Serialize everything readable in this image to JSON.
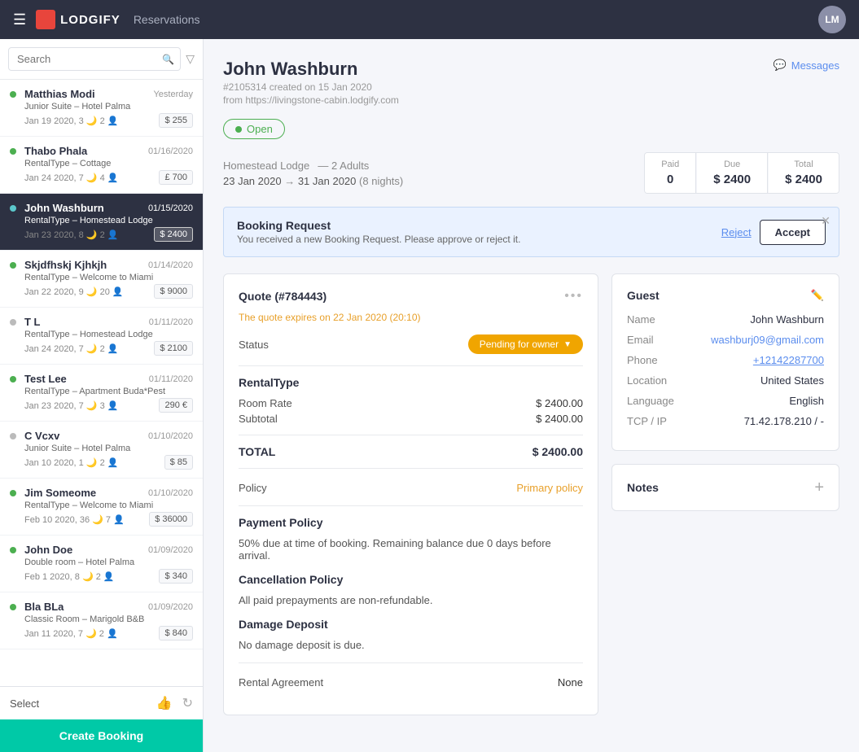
{
  "topnav": {
    "logo_text": "LODGIFY",
    "page_title": "Reservations",
    "avatar_initials": "LM"
  },
  "sidebar": {
    "search_placeholder": "Search",
    "select_label": "Select",
    "create_booking_label": "Create Booking",
    "items": [
      {
        "name": "Matthias Modi",
        "date": "Yesterday",
        "sub": "Junior Suite – Hotel Palma",
        "dates": "Jan 19 2020, 3",
        "adults": "2",
        "amount": "$ 255",
        "dot": "green",
        "active": false,
        "transfer": false
      },
      {
        "name": "Thabo Phala",
        "date": "01/16/2020",
        "sub": "RentalType – Cottage",
        "dates": "Jan 24 2020, 7",
        "adults": "4",
        "amount": "£ 700",
        "dot": "green",
        "active": false,
        "transfer": false
      },
      {
        "name": "John Washburn",
        "date": "01/15/2020",
        "sub": "RentalType – Homestead Lodge",
        "dates": "Jan 23 2020, 8",
        "adults": "2",
        "amount": "$ 2400",
        "dot": "green",
        "active": true,
        "transfer": true
      },
      {
        "name": "Skjdfhskj Kjhkjh",
        "date": "01/14/2020",
        "sub": "RentalType – Welcome to Miami",
        "dates": "Jan 22 2020, 9",
        "adults": "20",
        "amount": "$ 9000",
        "dot": "green",
        "active": false,
        "transfer": false
      },
      {
        "name": "T L",
        "date": "01/11/2020",
        "sub": "RentalType – Homestead Lodge",
        "dates": "Jan 24 2020, 7",
        "adults": "2",
        "amount": "$ 2100",
        "dot": "gray",
        "active": false,
        "transfer": true
      },
      {
        "name": "Test Lee",
        "date": "01/11/2020",
        "sub": "RentalType – Apartment Buda*Pest",
        "dates": "Jan 23 2020, 7",
        "adults": "3",
        "amount": "290 €",
        "dot": "green",
        "active": false,
        "transfer": false
      },
      {
        "name": "C Vcxv",
        "date": "01/10/2020",
        "sub": "Junior Suite – Hotel Palma",
        "dates": "Jan 10 2020, 1",
        "adults": "2",
        "amount": "$ 85",
        "dot": "gray",
        "active": false,
        "transfer": false
      },
      {
        "name": "Jim Someome",
        "date": "01/10/2020",
        "sub": "RentalType – Welcome to Miami",
        "dates": "Feb 10 2020, 36",
        "adults": "7",
        "amount": "$ 36000",
        "dot": "green",
        "active": false,
        "transfer": true
      },
      {
        "name": "John Doe",
        "date": "01/09/2020",
        "sub": "Double room – Hotel Palma",
        "dates": "Feb 1 2020, 8",
        "adults": "2",
        "amount": "$ 340",
        "dot": "green",
        "active": false,
        "transfer": false
      },
      {
        "name": "Bla BLa",
        "date": "01/09/2020",
        "sub": "Classic Room – Marigold B&B",
        "dates": "Jan 11 2020, 7",
        "adults": "2",
        "amount": "$ 840",
        "dot": "green",
        "active": false,
        "transfer": false
      }
    ]
  },
  "detail": {
    "guest_name": "John Washburn",
    "booking_id": "#2105314",
    "created": "created on 15 Jan 2020",
    "from_url": "from https://livingstone-cabin.lodgify.com",
    "status": "Open",
    "messages_label": "Messages",
    "property": "Homestead Lodge",
    "adults": "2 Adults",
    "check_in": "23 Jan 2020",
    "check_out": "31 Jan 2020",
    "nights": "8 nights",
    "paid_label": "Paid",
    "due_label": "Due",
    "total_label": "Total",
    "paid_value": "0",
    "due_value": "$ 2400",
    "total_value": "$ 2400",
    "alert": {
      "title": "Booking Request",
      "description": "You received a new Booking Request. Please approve or reject it.",
      "reject_label": "Reject",
      "accept_label": "Accept"
    },
    "quote": {
      "title": "Quote (#784443)",
      "expires": "The quote expires on 22 Jan 2020 (20:10)",
      "status_label": "Status",
      "status_value": "Pending for owner",
      "rental_type_title": "RentalType",
      "room_rate_label": "Room Rate",
      "room_rate_value": "$ 2400.00",
      "subtotal_label": "Subtotal",
      "subtotal_value": "$ 2400.00",
      "total_label": "TOTAL",
      "total_value": "$ 2400.00",
      "policy_label": "Policy",
      "policy_value": "Primary policy",
      "payment_policy_title": "Payment Policy",
      "payment_policy_desc": "50% due at time of booking. Remaining balance due 0 days before arrival.",
      "cancellation_title": "Cancellation Policy",
      "cancellation_desc": "All paid prepayments are non-refundable.",
      "damage_title": "Damage Deposit",
      "damage_desc": "No damage deposit is due.",
      "rental_agreement_label": "Rental Agreement",
      "rental_agreement_value": "None"
    },
    "guest": {
      "title": "Guest",
      "name_label": "Name",
      "name_value": "John Washburn",
      "email_label": "Email",
      "email_value": "washburj09@gmail.com",
      "phone_label": "Phone",
      "phone_value": "+12142287700",
      "location_label": "Location",
      "location_value": "United States",
      "language_label": "Language",
      "language_value": "English",
      "tcpip_label": "TCP / IP",
      "tcpip_value": "71.42.178.210 / -"
    },
    "notes": {
      "title": "Notes"
    }
  }
}
